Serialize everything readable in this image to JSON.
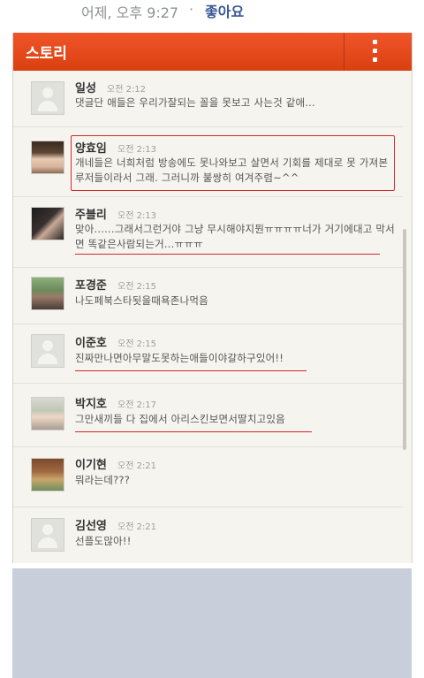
{
  "post": {
    "time": "어제, 오후 9:27",
    "separator": "·",
    "like_label": "좋아요"
  },
  "app": {
    "title": "스토리"
  },
  "comments": [
    {
      "name": "일성",
      "time": "오전 2:12",
      "text": "댓글단 애들은 우리가잘되는 꼴을 못보고 사는것 같애..."
    },
    {
      "name": "양효임",
      "time": "오전 2:13",
      "text": "개네들은 너희처럼 방송에도 못나와보고 살면서 기회를 제대로 못 가져본 루저들이라서 그래. 그러니까 불쌍히 여겨주렴~^^"
    },
    {
      "name": "주블리",
      "time": "오전 2:13",
      "text": "맞아......그래서그런거야 그냥 무시해야지뭔ㅠㅠㅠㅠ너가 거기에대고 막서면 똑같은사람되는거...ㅠㅠㅠ"
    },
    {
      "name": "포경준",
      "time": "오전 2:15",
      "text": "나도페북스타됫을때욕존나먹음"
    },
    {
      "name": "이준호",
      "time": "오전 2:15",
      "text": "진짜만나면아무말도못하는애들이야갈하구있어!!"
    },
    {
      "name": "박지호",
      "time": "오전 2:17",
      "text": "그만새끼들 다 집에서 아리스킨보면서딸치고있음"
    },
    {
      "name": "이기현",
      "time": "오전 2:21",
      "text": "뭐라는데???"
    },
    {
      "name": "김선영",
      "time": "오전 2:21",
      "text": "선플도많아!!"
    }
  ],
  "colors": {
    "header": "#e54a1c",
    "annotation": "#d02a2a",
    "bottom_panel": "#c8ceda"
  }
}
